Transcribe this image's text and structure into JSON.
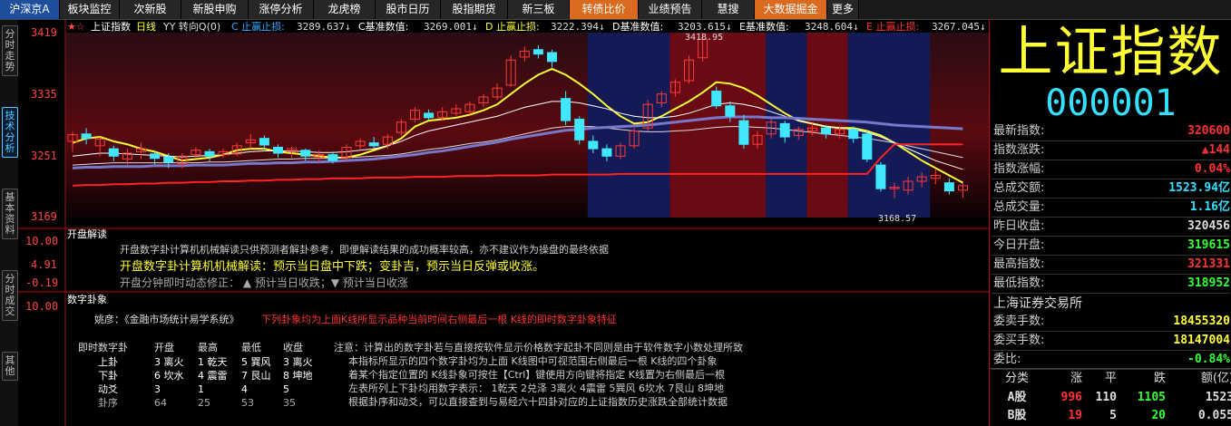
{
  "topbar": {
    "tabs": [
      {
        "label": "沪深京A",
        "w": 66,
        "style": "first"
      },
      {
        "label": "板块监控",
        "w": 66
      },
      {
        "label": "次新股",
        "w": 68
      },
      {
        "label": "新股申购",
        "w": 74
      },
      {
        "label": "涨停分析",
        "w": 72
      },
      {
        "label": "龙虎榜",
        "w": 68
      },
      {
        "label": "股市日历",
        "w": 72
      },
      {
        "label": "股指期货",
        "w": 74
      },
      {
        "label": "新三板",
        "w": 68
      },
      {
        "label": "转债比价",
        "w": 76,
        "style": "hl"
      },
      {
        "label": "业绩预告",
        "w": 70
      },
      {
        "label": "慧搜",
        "w": 58
      },
      {
        "label": "大数据掘金",
        "w": 80,
        "style": "hl"
      },
      {
        "label": "更多",
        "w": 35
      }
    ]
  },
  "left_tabs": [
    {
      "label": "分时走势",
      "active": false
    },
    {
      "label": "技术分析",
      "active": true
    },
    {
      "label": "基本资料",
      "active": false
    },
    {
      "label": "分时成交",
      "active": false
    },
    {
      "label": "其他",
      "active": false
    }
  ],
  "chart": {
    "header": {
      "name": "上证指数",
      "period": "日线",
      "indicator": "YY 转向Q(0)",
      "items": [
        {
          "label": "C 止赢止损:",
          "value": "3289.637↓",
          "color": "#33aaff"
        },
        {
          "label": "C基准数值:",
          "value": "3269.001↓",
          "color": "#ffffff"
        },
        {
          "label": "D 止赢止损:",
          "value": "3222.394↓",
          "color": "#ffff33"
        },
        {
          "label": "D基准数值:",
          "value": "3203.615↓",
          "color": "#ffffff"
        },
        {
          "label": "E基准数值:",
          "value": "3248.604↓",
          "color": "#ffffff"
        },
        {
          "label": "E 止赢止损:",
          "value": "3267.045↓",
          "color": "#ff3333"
        }
      ]
    },
    "y_axis": {
      "ticks": [
        "3419",
        "3335",
        "3251",
        "3169"
      ]
    },
    "annotations": {
      "high": "3418.95",
      "low": "3168.57"
    },
    "indicator_axis": {
      "ticks": [
        "10.00",
        "4.91",
        "-0.19"
      ]
    },
    "bottom_axis": {
      "ticks": [
        "10.00"
      ]
    }
  },
  "chart_data": {
    "type": "candlestick",
    "ylim": [
      3169,
      3419
    ],
    "candles": [
      {
        "o": 3272,
        "c": 3281,
        "h": 3285,
        "l": 3258
      },
      {
        "o": 3282,
        "c": 3276,
        "h": 3290,
        "l": 3268
      },
      {
        "o": 3266,
        "c": 3275,
        "h": 3278,
        "l": 3252
      },
      {
        "o": 3262,
        "c": 3252,
        "h": 3266,
        "l": 3245
      },
      {
        "o": 3248,
        "c": 3256,
        "h": 3262,
        "l": 3240
      },
      {
        "o": 3258,
        "c": 3262,
        "h": 3270,
        "l": 3248
      },
      {
        "o": 3255,
        "c": 3249,
        "h": 3258,
        "l": 3241
      },
      {
        "o": 3251,
        "c": 3244,
        "h": 3256,
        "l": 3236
      },
      {
        "o": 3242,
        "c": 3252,
        "h": 3256,
        "l": 3236
      },
      {
        "o": 3254,
        "c": 3260,
        "h": 3264,
        "l": 3250
      },
      {
        "o": 3258,
        "c": 3252,
        "h": 3262,
        "l": 3245
      },
      {
        "o": 3254,
        "c": 3258,
        "h": 3262,
        "l": 3250
      },
      {
        "o": 3255,
        "c": 3266,
        "h": 3270,
        "l": 3252
      },
      {
        "o": 3270,
        "c": 3274,
        "h": 3282,
        "l": 3262
      },
      {
        "o": 3276,
        "c": 3267,
        "h": 3280,
        "l": 3262
      },
      {
        "o": 3264,
        "c": 3256,
        "h": 3268,
        "l": 3250
      },
      {
        "o": 3258,
        "c": 3262,
        "h": 3265,
        "l": 3250
      },
      {
        "o": 3260,
        "c": 3252,
        "h": 3262,
        "l": 3246
      },
      {
        "o": 3250,
        "c": 3254,
        "h": 3260,
        "l": 3244
      },
      {
        "o": 3254,
        "c": 3246,
        "h": 3258,
        "l": 3242
      },
      {
        "o": 3250,
        "c": 3264,
        "h": 3268,
        "l": 3246
      },
      {
        "o": 3266,
        "c": 3272,
        "h": 3276,
        "l": 3260
      },
      {
        "o": 3270,
        "c": 3266,
        "h": 3278,
        "l": 3262
      },
      {
        "o": 3268,
        "c": 3278,
        "h": 3282,
        "l": 3262
      },
      {
        "o": 3284,
        "c": 3298,
        "h": 3302,
        "l": 3280
      },
      {
        "o": 3302,
        "c": 3314,
        "h": 3318,
        "l": 3298
      },
      {
        "o": 3310,
        "c": 3304,
        "h": 3315,
        "l": 3300
      },
      {
        "o": 3304,
        "c": 3312,
        "h": 3318,
        "l": 3300
      },
      {
        "o": 3310,
        "c": 3316,
        "h": 3322,
        "l": 3306
      },
      {
        "o": 3312,
        "c": 3322,
        "h": 3326,
        "l": 3308
      },
      {
        "o": 3324,
        "c": 3332,
        "h": 3336,
        "l": 3318
      },
      {
        "o": 3332,
        "c": 3344,
        "h": 3350,
        "l": 3328
      },
      {
        "o": 3348,
        "c": 3382,
        "h": 3388,
        "l": 3346
      },
      {
        "o": 3386,
        "c": 3394,
        "h": 3400,
        "l": 3380
      },
      {
        "o": 3396,
        "c": 3390,
        "h": 3402,
        "l": 3384
      },
      {
        "o": 3392,
        "c": 3380,
        "h": 3396,
        "l": 3372
      },
      {
        "o": 3330,
        "c": 3300,
        "h": 3340,
        "l": 3294
      },
      {
        "o": 3302,
        "c": 3274,
        "h": 3306,
        "l": 3268
      },
      {
        "o": 3272,
        "c": 3262,
        "h": 3280,
        "l": 3256
      },
      {
        "o": 3262,
        "c": 3252,
        "h": 3268,
        "l": 3245
      },
      {
        "o": 3252,
        "c": 3266,
        "h": 3270,
        "l": 3248
      },
      {
        "o": 3266,
        "c": 3286,
        "h": 3290,
        "l": 3262
      },
      {
        "o": 3290,
        "c": 3322,
        "h": 3328,
        "l": 3286
      },
      {
        "o": 3324,
        "c": 3336,
        "h": 3340,
        "l": 3318
      },
      {
        "o": 3338,
        "c": 3352,
        "h": 3356,
        "l": 3332
      },
      {
        "o": 3354,
        "c": 3382,
        "h": 3388,
        "l": 3350
      },
      {
        "o": 3385,
        "c": 3410,
        "h": 3418.95,
        "l": 3380
      },
      {
        "o": 3340,
        "c": 3320,
        "h": 3346,
        "l": 3316
      },
      {
        "o": 3320,
        "c": 3306,
        "h": 3326,
        "l": 3298
      },
      {
        "o": 3300,
        "c": 3268,
        "h": 3308,
        "l": 3262
      },
      {
        "o": 3268,
        "c": 3280,
        "h": 3286,
        "l": 3262
      },
      {
        "o": 3282,
        "c": 3298,
        "h": 3302,
        "l": 3276
      },
      {
        "o": 3296,
        "c": 3278,
        "h": 3300,
        "l": 3270
      },
      {
        "o": 3280,
        "c": 3288,
        "h": 3292,
        "l": 3274
      },
      {
        "o": 3286,
        "c": 3290,
        "h": 3296,
        "l": 3280
      },
      {
        "o": 3290,
        "c": 3282,
        "h": 3294,
        "l": 3276
      },
      {
        "o": 3282,
        "c": 3288,
        "h": 3292,
        "l": 3276
      },
      {
        "o": 3288,
        "c": 3276,
        "h": 3292,
        "l": 3270
      },
      {
        "o": 3282,
        "c": 3248,
        "h": 3286,
        "l": 3244
      },
      {
        "o": 3240,
        "c": 3208,
        "h": 3244,
        "l": 3204
      },
      {
        "o": 3208,
        "c": 3210,
        "h": 3216,
        "l": 3195
      },
      {
        "o": 3206,
        "c": 3218,
        "h": 3224,
        "l": 3200
      },
      {
        "o": 3218,
        "c": 3224,
        "h": 3230,
        "l": 3210
      },
      {
        "o": 3222,
        "c": 3226,
        "h": 3234,
        "l": 3214
      },
      {
        "o": 3216,
        "c": 3205,
        "h": 3222,
        "l": 3200
      },
      {
        "o": 3206,
        "c": 3212,
        "h": 3216,
        "l": 3196
      }
    ],
    "lines": [
      {
        "name": "C",
        "color": "#ffff33",
        "width": 2,
        "values": [
          3270,
          3276,
          3278,
          3272,
          3268,
          3262,
          3258,
          3252,
          3246,
          3248,
          3250,
          3254,
          3260,
          3262,
          3262,
          3258,
          3256,
          3254,
          3252,
          3250,
          3250,
          3254,
          3260,
          3266,
          3276,
          3292,
          3300,
          3302,
          3304,
          3308,
          3314,
          3322,
          3336,
          3350,
          3362,
          3370,
          3362,
          3350,
          3336,
          3320,
          3306,
          3296,
          3298,
          3306,
          3316,
          3326,
          3338,
          3352,
          3350,
          3344,
          3334,
          3322,
          3310,
          3300,
          3296,
          3292,
          3290,
          3290,
          3286,
          3280,
          3270,
          3258,
          3246,
          3236,
          3226,
          3216
        ]
      },
      {
        "name": "W1",
        "color": "#ffffff",
        "width": 1,
        "values": [
          3252,
          3254,
          3256,
          3256,
          3255,
          3254,
          3253,
          3252,
          3251,
          3252,
          3253,
          3254,
          3256,
          3258,
          3259,
          3259,
          3259,
          3258,
          3257,
          3257,
          3258,
          3260,
          3262,
          3266,
          3272,
          3280,
          3286,
          3290,
          3294,
          3298,
          3302,
          3306,
          3312,
          3318,
          3322,
          3326,
          3326,
          3324,
          3320,
          3316,
          3310,
          3306,
          3304,
          3304,
          3306,
          3310,
          3316,
          3322,
          3324,
          3322,
          3318,
          3312,
          3306,
          3300,
          3296,
          3292,
          3290,
          3288,
          3284,
          3278,
          3270,
          3262,
          3254,
          3246,
          3240,
          3234
        ]
      },
      {
        "name": "W2",
        "color": "#dddddd",
        "width": 1,
        "values": [
          3240,
          3241,
          3242,
          3243,
          3243,
          3243,
          3243,
          3243,
          3243,
          3243,
          3244,
          3244,
          3245,
          3246,
          3247,
          3248,
          3248,
          3249,
          3249,
          3249,
          3250,
          3251,
          3252,
          3253,
          3255,
          3258,
          3261,
          3263,
          3266,
          3269,
          3271,
          3274,
          3278,
          3282,
          3286,
          3290,
          3292,
          3292,
          3292,
          3290,
          3288,
          3286,
          3285,
          3285,
          3286,
          3287,
          3289,
          3291,
          3292,
          3292,
          3291,
          3290,
          3288,
          3286,
          3284,
          3282,
          3280,
          3278,
          3276,
          3273,
          3270,
          3266,
          3262,
          3258,
          3254,
          3250
        ]
      },
      {
        "name": "B",
        "color": "#7777cc",
        "width": 3,
        "values": [
          3236,
          3237,
          3237,
          3238,
          3238,
          3238,
          3239,
          3239,
          3239,
          3240,
          3240,
          3240,
          3241,
          3242,
          3242,
          3243,
          3243,
          3244,
          3244,
          3245,
          3246,
          3247,
          3248,
          3250,
          3252,
          3254,
          3257,
          3259,
          3262,
          3265,
          3268,
          3271,
          3275,
          3278,
          3281,
          3284,
          3287,
          3288,
          3290,
          3291,
          3292,
          3293,
          3294,
          3296,
          3298,
          3300,
          3302,
          3304,
          3305,
          3305,
          3305,
          3304,
          3304,
          3303,
          3302,
          3301,
          3300,
          3299,
          3298,
          3296,
          3294,
          3293,
          3292,
          3291,
          3290,
          3289
        ]
      },
      {
        "name": "E",
        "color": "#ff2222",
        "width": 2,
        "values": [
          3212,
          3213,
          3213,
          3214,
          3214,
          3215,
          3215,
          3216,
          3216,
          3217,
          3217,
          3218,
          3218,
          3219,
          3219,
          3220,
          3220,
          3221,
          3221,
          3222,
          3222,
          3222,
          3223,
          3223,
          3223,
          3224,
          3224,
          3224,
          3225,
          3225,
          3225,
          3226,
          3226,
          3226,
          3226,
          3227,
          3227,
          3227,
          3227,
          3227,
          3228,
          3228,
          3228,
          3228,
          3228,
          3228,
          3228,
          3228,
          3228,
          3228,
          3228,
          3228,
          3228,
          3228,
          3228,
          3228,
          3228,
          3228,
          3228,
          3250,
          3268,
          3268,
          3268,
          3268,
          3268,
          3268
        ]
      }
    ],
    "blue_ranges": [
      [
        38,
        44
      ],
      [
        51,
        54
      ],
      [
        57,
        63
      ]
    ],
    "red_ranges": [
      [
        44,
        51
      ],
      [
        54,
        57
      ]
    ]
  },
  "divination": {
    "title": "开盘解读",
    "line1": "开盘数字卦计算机机械解读只供预测者解卦参考，即便解读结果的成功概率较高，亦不建议作为操盘的最终依据",
    "line2": "开盘数字卦计算机机械解读：预示当日盘中下跌；变卦吉，预示当日反弹或收涨。",
    "line3": "开盘分钟即时动态修正：  ▲  预计当日收跌；▼  预计当日收涨"
  },
  "gua": {
    "title": "数字卦象",
    "source": "姚彦：《金融市场统计易学系统》",
    "source_note": "下列卦象均为上面K线所显示品种当前时间右侧最后一根  K线的即时数字卦象特征",
    "table_headers": [
      "即时数字卦",
      "开盘",
      "最高",
      "最低",
      "收盘"
    ],
    "table_rows": [
      [
        "上卦",
        "3 离火",
        "1 乾天",
        "5 巽风",
        "3 离火"
      ],
      [
        "下卦",
        "6 坎水",
        "4 震雷",
        "7 艮山",
        "8 坤地"
      ],
      [
        "动爻",
        "3",
        "1",
        "4",
        "5"
      ],
      [
        "卦序",
        "64",
        "25",
        "53",
        "35"
      ]
    ],
    "note_lines": [
      "注意：计算出的数字卦若与直接按软件显示价格数字起卦不同则是由于软件数字小数处理所致",
      "本指标所显示的四个数字卦均为上面  K线图中可视范围右侧最后一根  K线的四个卦象",
      "着某个指定位置的  K线卦象可按住【Ctrl】键使用方向键将指定  K线置为右侧最后一根",
      "左表所列上下卦均用数字表示：  1乾天 2兑泽 3离火 4震雷 5巽风 6坎水 7艮山 8坤地",
      "根据卦序和动爻，可以直接查到与易经六十四卦对应的上证指数历史涨跌全部统计数据"
    ]
  },
  "quote": {
    "name": "上证指数",
    "code": "000001",
    "rows": [
      {
        "k": "最新指数:",
        "v": "320600",
        "color": "r"
      },
      {
        "k": "指数涨跌:",
        "v": "▲144",
        "color": "r"
      },
      {
        "k": "指数涨幅:",
        "v": "0.04%",
        "color": "r"
      },
      {
        "k": "总成交额:",
        "v": "1523.94亿",
        "color": "c"
      },
      {
        "k": "总成交量:",
        "v": "1.16亿",
        "color": "c"
      },
      {
        "k": "昨日收盘:",
        "v": "320456",
        "color": "w"
      },
      {
        "k": "今日开盘:",
        "v": "319615",
        "color": "g"
      },
      {
        "k": "最高指数:",
        "v": "321331",
        "color": "r"
      },
      {
        "k": "最低指数:",
        "v": "318952",
        "color": "g"
      }
    ],
    "exchange": "上海证券交易所",
    "rows2": [
      {
        "k": "委卖手数:",
        "v": "18455320",
        "color": "y"
      },
      {
        "k": "委买手数:",
        "v": "18147004",
        "color": "y"
      },
      {
        "k": "委比:",
        "v": "-0.84%",
        "color": "g"
      }
    ],
    "breadth_headers": [
      "分类",
      "涨",
      "平",
      "跌",
      "额(亿)"
    ],
    "breadth_rows": [
      [
        "A股",
        "996",
        "110",
        "1105",
        "1523"
      ],
      [
        "B股",
        "19",
        "5",
        "20",
        "0.055"
      ]
    ]
  }
}
